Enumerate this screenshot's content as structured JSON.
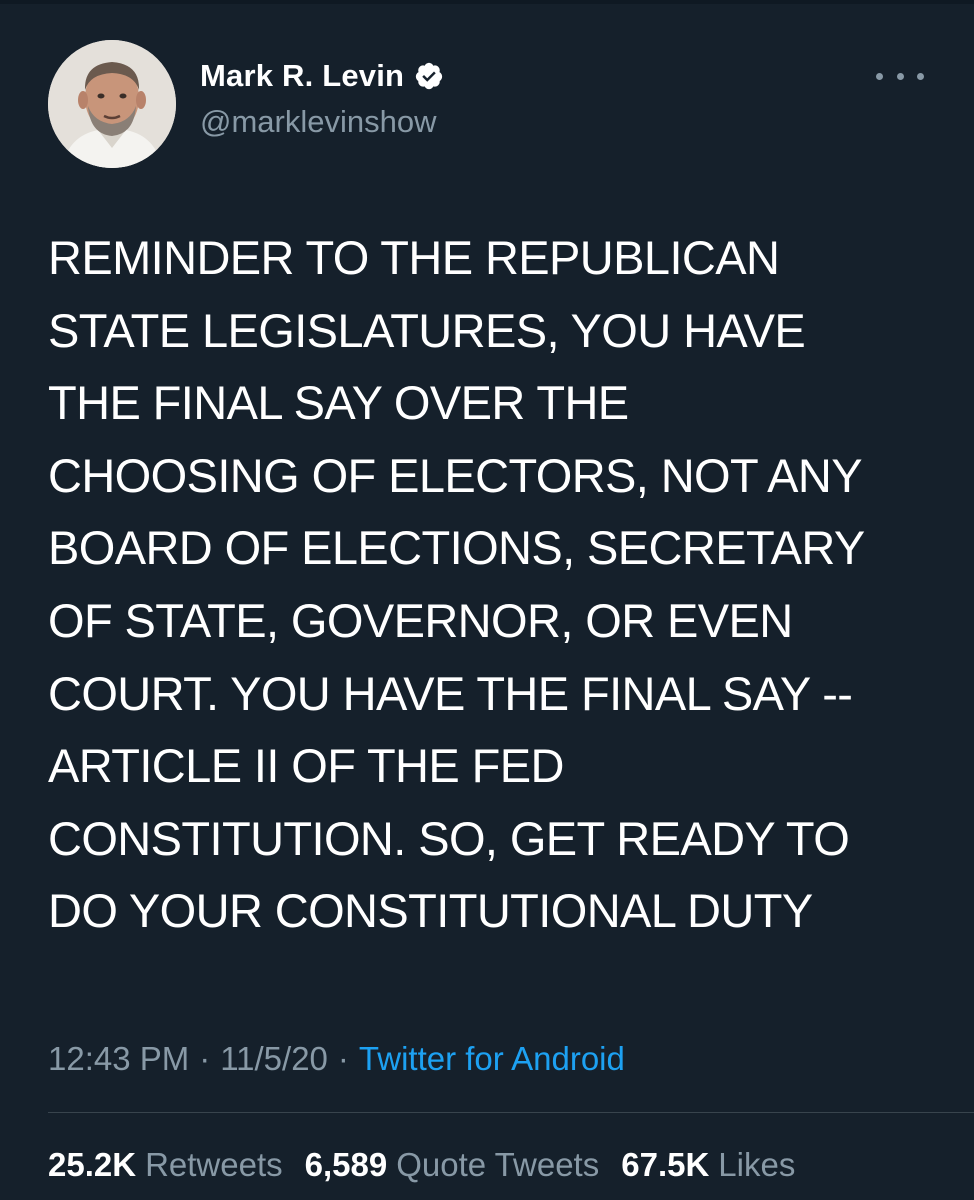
{
  "author": {
    "display_name": "Mark R. Levin",
    "handle": "@marklevinshow",
    "verified": true,
    "avatar_icon": "profile-photo"
  },
  "more_icon": "more-horizontal-icon",
  "tweet": {
    "lines": [
      "REMINDER TO THE REPUBLICAN",
      "STATE LEGISLATURES, YOU HAVE",
      "THE FINAL SAY OVER THE",
      "CHOOSING OF ELECTORS, NOT ANY",
      "BOARD OF ELECTIONS, SECRETARY",
      "OF STATE, GOVERNOR, OR EVEN",
      "COURT. YOU HAVE THE FINAL SAY --",
      "ARTICLE II OF THE FED",
      "CONSTITUTION. SO, GET READY TO",
      "DO YOUR CONSTITUTIONAL DUTY"
    ]
  },
  "meta": {
    "time": "12:43 PM",
    "separator": "·",
    "date": "11/5/20",
    "source": "Twitter for Android"
  },
  "stats": {
    "retweets": {
      "count": "25.2K",
      "label": "Retweets"
    },
    "quotes": {
      "count": "6,589",
      "label": "Quote Tweets"
    },
    "likes": {
      "count": "67.5K",
      "label": "Likes"
    }
  },
  "colors": {
    "background": "#15202b",
    "secondary_text": "#8899a6",
    "link": "#1da1f2",
    "divider": "#38444d"
  }
}
